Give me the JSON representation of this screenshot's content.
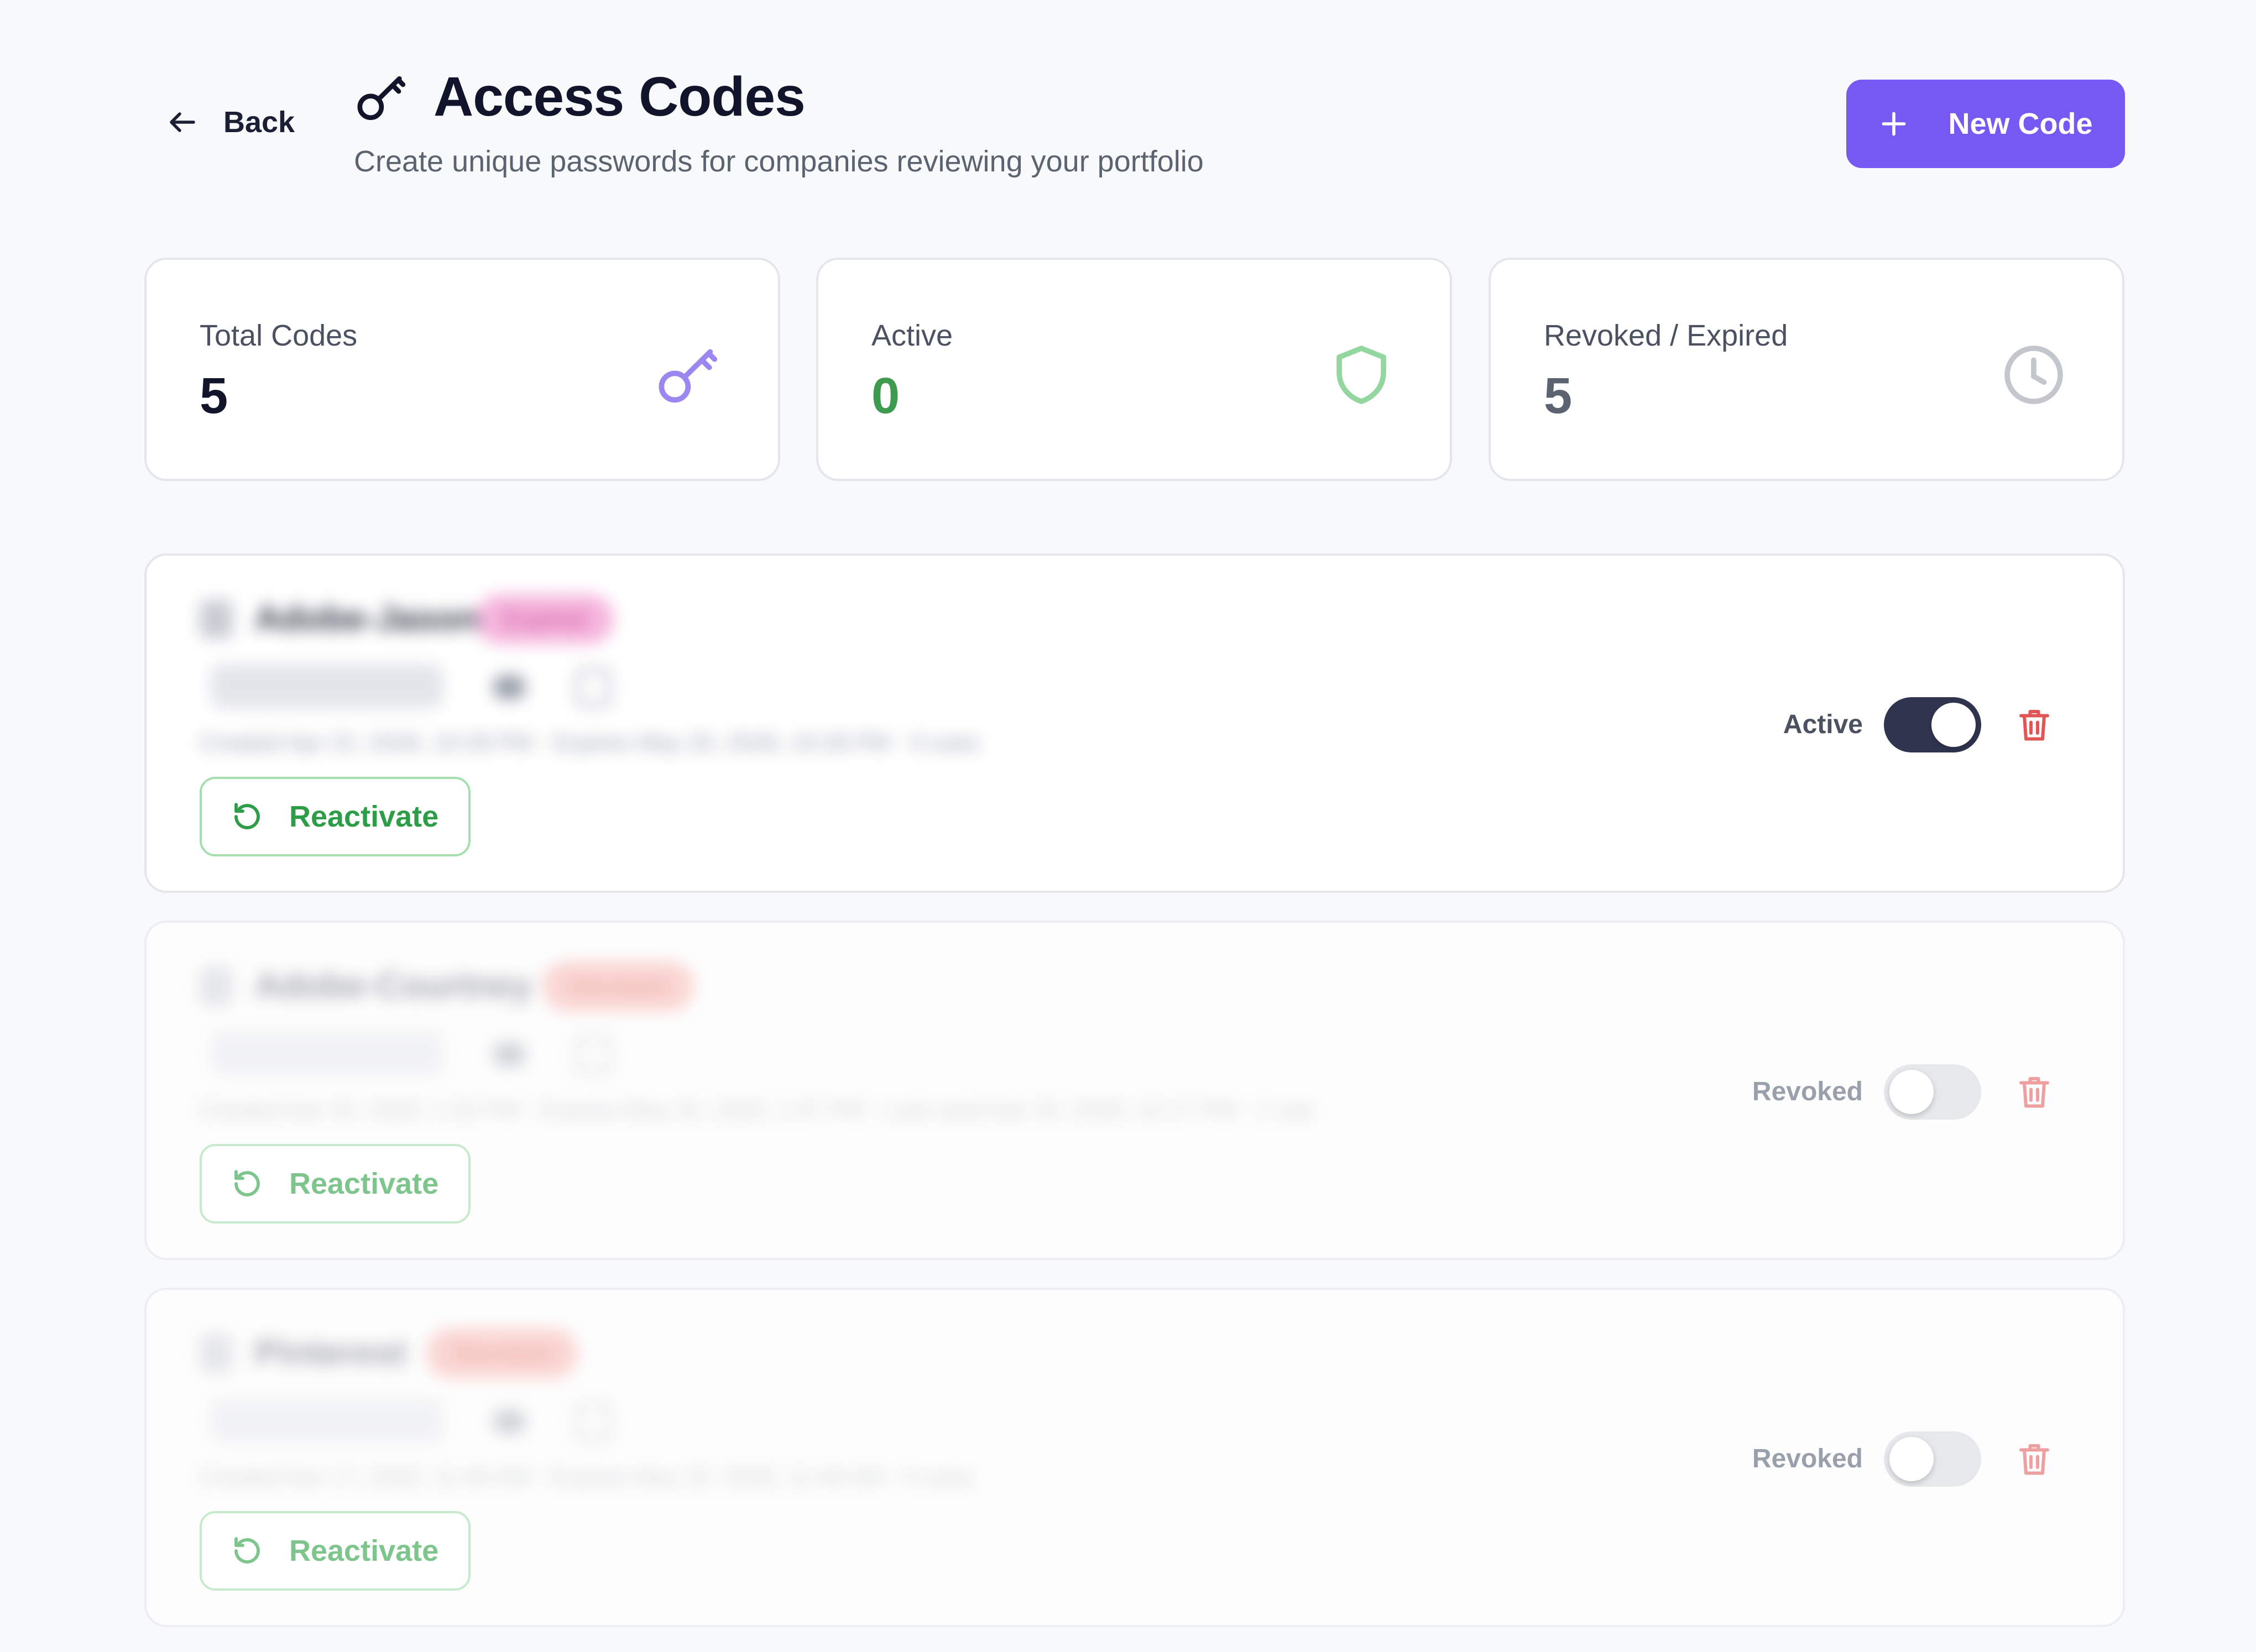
{
  "header": {
    "back_label": "Back",
    "title": "Access Codes",
    "subtitle": "Create unique passwords for companies reviewing your portfolio",
    "new_code_label": "New Code"
  },
  "stats": [
    {
      "label": "Total Codes",
      "value": "5",
      "icon": "key-icon",
      "value_color": "#11142a",
      "icon_color": "#9c86f0"
    },
    {
      "label": "Active",
      "value": "0",
      "icon": "shield-icon",
      "value_color": "#3e9a4e",
      "icon_color": "#94d69f"
    },
    {
      "label": "Revoked / Expired",
      "value": "5",
      "icon": "clock-icon",
      "value_color": "#5c6370",
      "icon_color": "#c3c6cd"
    }
  ],
  "codes": [
    {
      "name": "Adobe-Jason",
      "badge": "Expired",
      "meta": "Created Apr 22, 2026, 10:28 PM   ·   Expires May 20, 2026, 10:28 PM   ·   0 uses",
      "reactivate_label": "Reactivate",
      "status_label": "Active",
      "toggle_on": true
    },
    {
      "name": "Adobe-Courtney",
      "badge": "Revoked",
      "meta": "Created Apr 22, 2026, 1:32 PM   ·   Expires May 20, 2026, 1:47 PM   ·   Last used Apr 23, 2026, 12:17 PM   ·   1 use",
      "reactivate_label": "Reactivate",
      "status_label": "Revoked",
      "toggle_on": false
    },
    {
      "name": "Pinterest",
      "badge": "Revoked",
      "meta": "Created Apr 17, 2026, 11:46 AM   ·   Expires May 15, 2026, 11:46 AM   ·   0 uses",
      "reactivate_label": "Reactivate",
      "status_label": "Revoked",
      "toggle_on": false
    }
  ],
  "colors": {
    "accent": "#7658f2",
    "success": "#2e9d47",
    "danger": "#e25555",
    "toggle_on": "#30354f"
  }
}
